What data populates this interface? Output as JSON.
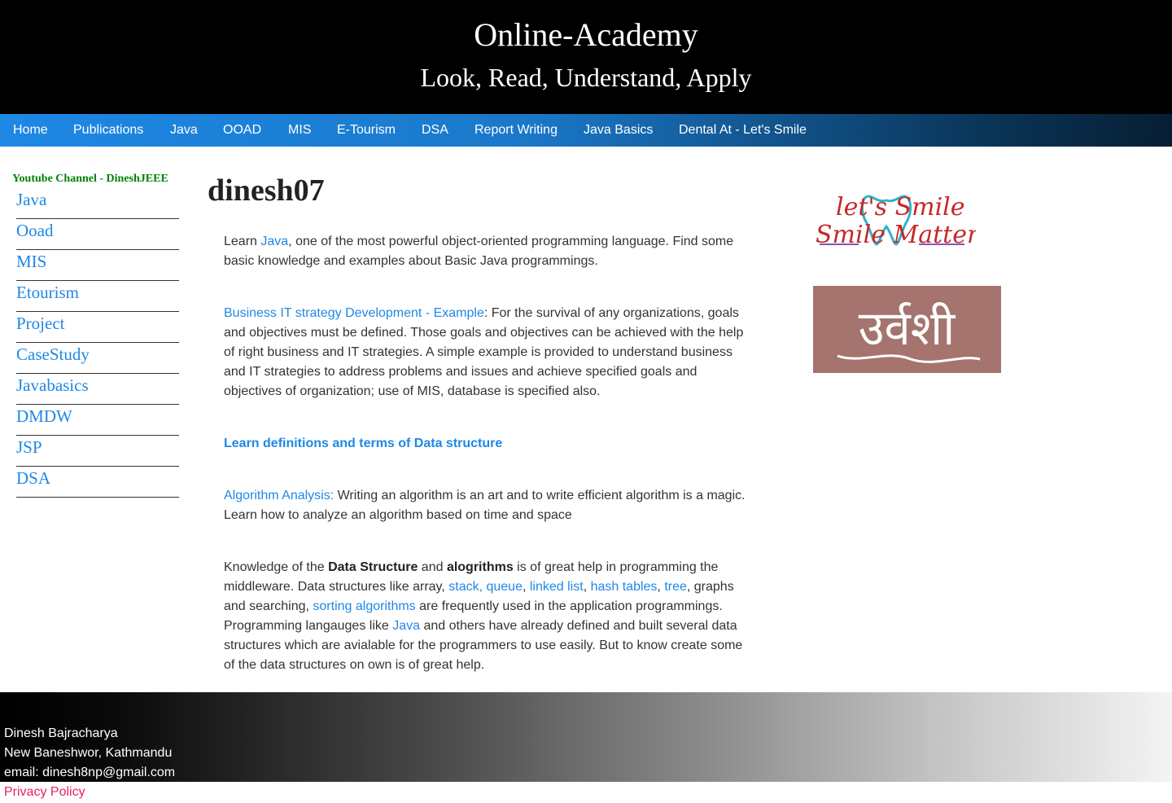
{
  "header": {
    "title": "Online-Academy",
    "tagline": "Look, Read, Understand, Apply"
  },
  "nav": {
    "items": [
      "Home",
      "Publications",
      "Java",
      "OOAD",
      "MIS",
      "E-Tourism",
      "DSA",
      "Report Writing",
      "Java Basics",
      "Dental At - Let's Smile"
    ]
  },
  "sidebar": {
    "heading": "Youtube Channel - DineshJEEE",
    "items": [
      "Java",
      "Ooad",
      "MIS",
      "Etourism",
      "Project",
      "CaseStudy",
      "Javabasics",
      "DMDW",
      "JSP",
      "DSA"
    ]
  },
  "main": {
    "title": "dinesh07",
    "p1": {
      "before": "Learn ",
      "link": "Java",
      "after": ", one of the most powerful object-oriented programming language. Find some basic knowledge and examples about Basic Java programmings."
    },
    "p2": {
      "link": "Business IT strategy Development - Example",
      "after": ": For the survival of any organizations, goals and objectives must be defined. Those goals and objectives can be achieved with the help of right business and IT strategies. A simple example is provided to understand business and IT strategies to address problems and issues and achieve specified goals and objectives of organization; use of MIS, database is specified also."
    },
    "p3": {
      "link": "Learn definitions and terms of Data structure"
    },
    "p4": {
      "link": "Algorithm Analysis:",
      "after": " Writing an algorithm is an art and to write efficient algorithm is a magic. Learn how to analyze an algorithm based on time and space"
    },
    "p5": {
      "t1": "Knowledge of the ",
      "b1": "Data Structure",
      "t2": " and ",
      "b2": "alogrithms",
      "t3": " is of great help in programming the middleware. Data structures like array, ",
      "l1": "stack, queue",
      "t4": ", ",
      "l2": "linked list",
      "t5": ", ",
      "l3": "hash tables",
      "t6": ", ",
      "l4": "tree",
      "t7": ", graphs and searching, ",
      "l5": "sorting algorithms",
      "t8": " are frequently used in the application programmings. Programming langauges like ",
      "l6": "Java",
      "t9": " and others have already defined and built several data structures which are avialable for the programmers to use easily. But to know create some of the data structures on own is of great help."
    }
  },
  "ads": {
    "smile_line1": "let's Smile",
    "smile_line2": "Smile Matters",
    "urvashi_text": "उर्वशी"
  },
  "footer": {
    "name": "Dinesh Bajracharya",
    "address": "New Baneshwor, Kathmandu",
    "email": "email: dinesh8np@gmail.com",
    "privacy": "Privacy Policy"
  },
  "colors": {
    "link": "#1e88e5",
    "sidebar_heading": "#008000",
    "privacy": "#e91e63"
  }
}
